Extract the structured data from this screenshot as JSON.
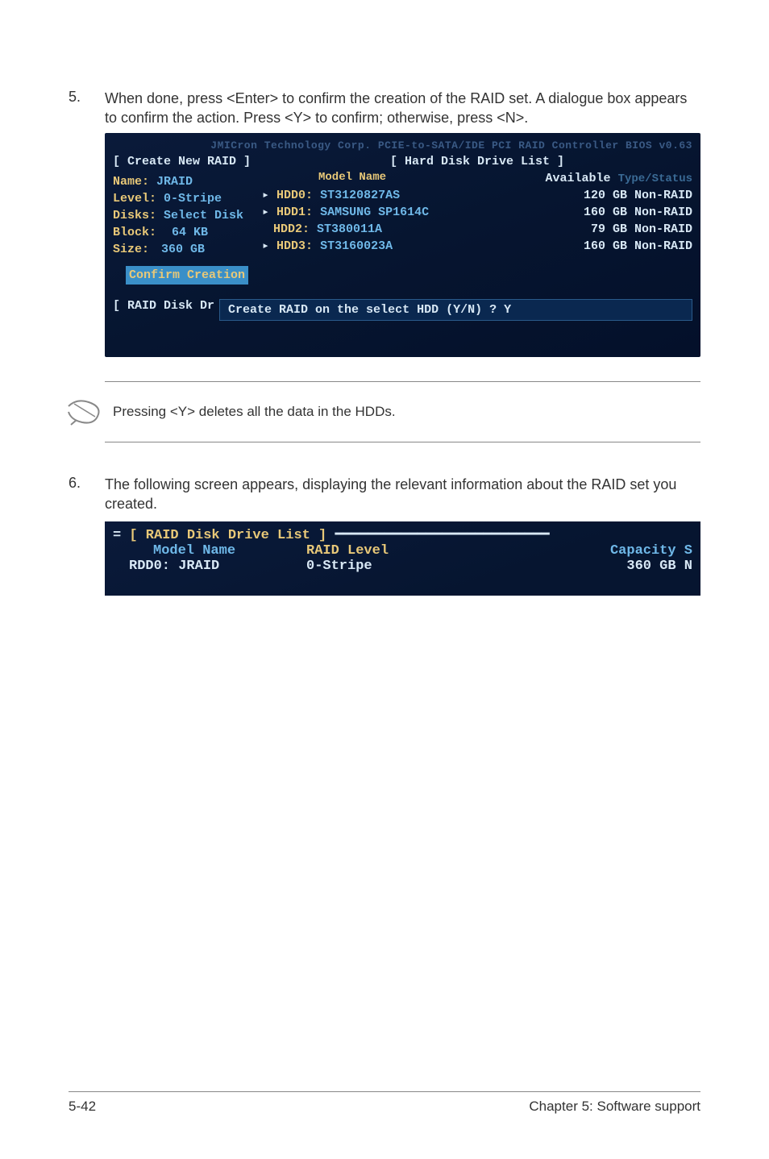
{
  "step5": {
    "num": "5.",
    "text": "When done, press <Enter> to confirm the creation of the RAID set. A dialogue box appears to confirm the action. Press <Y> to confirm; otherwise, press <N>."
  },
  "bios1": {
    "topFaint": "JMICron Technology Corp. PCIE-to-SATA/IDE PCI RAID Controller BIOS v0.63",
    "createTitle": "[ Create New RAID ]",
    "driveListTitle": "[ Hard Disk Drive List ]",
    "modelHeader": "Model Name",
    "availHeader": "Available",
    "typeHeader": "Type/Status",
    "left": {
      "nameLabel": "Name:",
      "nameVal": "JRAID",
      "levelLabel": "Level:",
      "levelVal": "0-Stripe",
      "disksLabel": "Disks:",
      "disksVal": "Select Disk",
      "blockLabel": "Block:",
      "blockVal": "64 KB",
      "sizeLabel": "Size:",
      "sizeVal": "360 GB"
    },
    "drives": [
      {
        "marker": "▸",
        "id": "HDD0:",
        "model": "ST3120827AS",
        "size": "120 GB",
        "status": "Non-RAID"
      },
      {
        "marker": "▸",
        "id": "HDD1:",
        "model": "SAMSUNG SP1614C",
        "size": "160 GB",
        "status": "Non-RAID"
      },
      {
        "marker": "",
        "id": "HDD2:",
        "model": "ST380011A",
        "size": "79 GB",
        "status": "Non-RAID"
      },
      {
        "marker": "▸",
        "id": "HDD3:",
        "model": "ST3160023A",
        "size": "160 GB",
        "status": "Non-RAID"
      }
    ],
    "confirmBtn": "Confirm Creation",
    "raidDiskLabel": "[ RAID Disk Dr",
    "promptText": "Create RAID on the select HDD (Y/N) ? Y"
  },
  "note": {
    "text": "Pressing <Y> deletes all the data in the HDDs."
  },
  "step6": {
    "num": "6.",
    "text": "The following screen appears, displaying the relevant information about the RAID set you created."
  },
  "bios2": {
    "title": "[ RAID Disk Drive List ]",
    "hModel": "Model Name",
    "hLevel": "RAID Level",
    "hCap": "Capacity S",
    "rModel": "RDD0: JRAID",
    "rLevel": "0-Stripe",
    "rCap": "360 GB N"
  },
  "footer": {
    "left": "5-42",
    "right": "Chapter 5: Software support"
  }
}
